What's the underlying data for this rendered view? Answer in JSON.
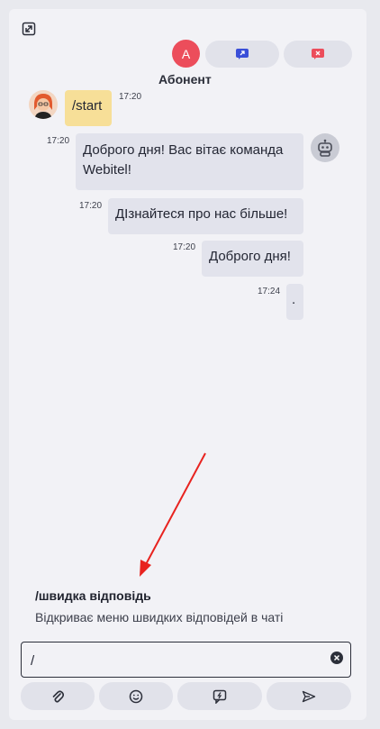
{
  "header": {
    "avatar_letter": "A",
    "subscriber_label": "Абонент",
    "transfer_color": "#3a4fd8",
    "close_color": "#ec4d5b"
  },
  "messages": [
    {
      "from": "client",
      "text": "/start",
      "time": "17:20"
    },
    {
      "from": "bot",
      "text": "Доброго дня! Вас вітає команда Webitel!",
      "time": "17:20"
    },
    {
      "from": "bot",
      "text": "ДІзнайтеся про нас більше!",
      "time": "17:20"
    },
    {
      "from": "bot",
      "text": "Доброго дня!",
      "time": "17:20"
    },
    {
      "from": "bot",
      "text": ".",
      "time": "17:24"
    }
  ],
  "quick_reply": {
    "title": "/швидка відповідь",
    "description": "Відкриває меню швидких відповідей в чаті"
  },
  "input": {
    "value": "/",
    "placeholder": ""
  },
  "toolbar": {
    "icons": [
      "paperclip-icon",
      "smile-icon",
      "quick-reply-icon",
      "send-icon"
    ]
  },
  "annotation": {
    "arrow_color": "#e8231f"
  }
}
